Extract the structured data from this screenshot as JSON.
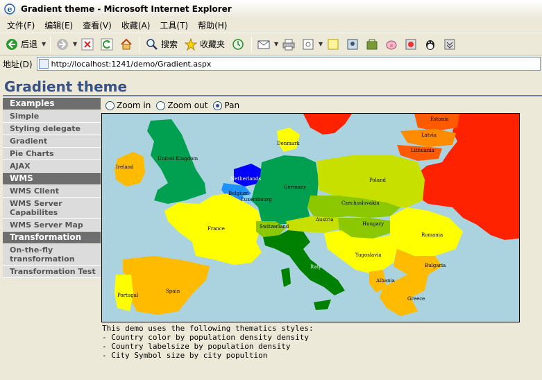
{
  "window": {
    "title": "Gradient theme - Microsoft Internet Explorer"
  },
  "menu": {
    "items": [
      "文件(F)",
      "编辑(E)",
      "查看(V)",
      "收藏(A)",
      "工具(T)",
      "帮助(H)"
    ]
  },
  "toolbar": {
    "back_label": "后退",
    "search_label": "搜索",
    "favorites_label": "收藏夹"
  },
  "address": {
    "label": "地址(D)",
    "url": "http://localhost:1241/demo/Gradient.aspx"
  },
  "page": {
    "title": "Gradient theme"
  },
  "sidebar": {
    "sections": [
      {
        "header": "Examples",
        "items": [
          "Simple",
          "Styling delegate",
          "Gradient",
          "Pie Charts",
          "AJAX"
        ]
      },
      {
        "header": "WMS",
        "items": [
          "WMS Client",
          "WMS Server Capabilites",
          "WMS Server Map"
        ]
      },
      {
        "header": "Transformation",
        "items": [
          "On-the-fly transformation",
          "Transformation Test"
        ]
      }
    ]
  },
  "tools": {
    "zoom_in": "Zoom in",
    "zoom_out": "Zoom out",
    "pan": "Pan",
    "selected": "pan"
  },
  "map": {
    "labels": [
      "Estonia",
      "Latvia",
      "Lithuania",
      "Denmark",
      "United Kingdom",
      "Ireland",
      "Netherlands",
      "Belgium",
      "Luxembourg",
      "Germany",
      "Poland",
      "Czechoslovakia",
      "France",
      "Switzerland",
      "Austria",
      "Hungary",
      "Romania",
      "Yugoslavia",
      "Italy",
      "Bulgaria",
      "Albania",
      "Portugal",
      "Spain",
      "Greece"
    ],
    "colors": {
      "water": "#aad3df",
      "red": "#ff2200",
      "orange_red": "#ff5a00",
      "orange": "#ff8c00",
      "amber": "#ffbb00",
      "yellow": "#ffff00",
      "lime": "#c8e000",
      "light_green": "#8cc800",
      "green": "#00a050",
      "dark_green": "#008000",
      "blue": "#0000ff",
      "light_blue": "#1e90ff"
    }
  },
  "description": {
    "intro": "This demo uses the following thematics styles:",
    "lines": [
      "- Country color by population density density",
      "- Country labelsize by population density",
      "- City Symbol size by city popultion"
    ]
  }
}
